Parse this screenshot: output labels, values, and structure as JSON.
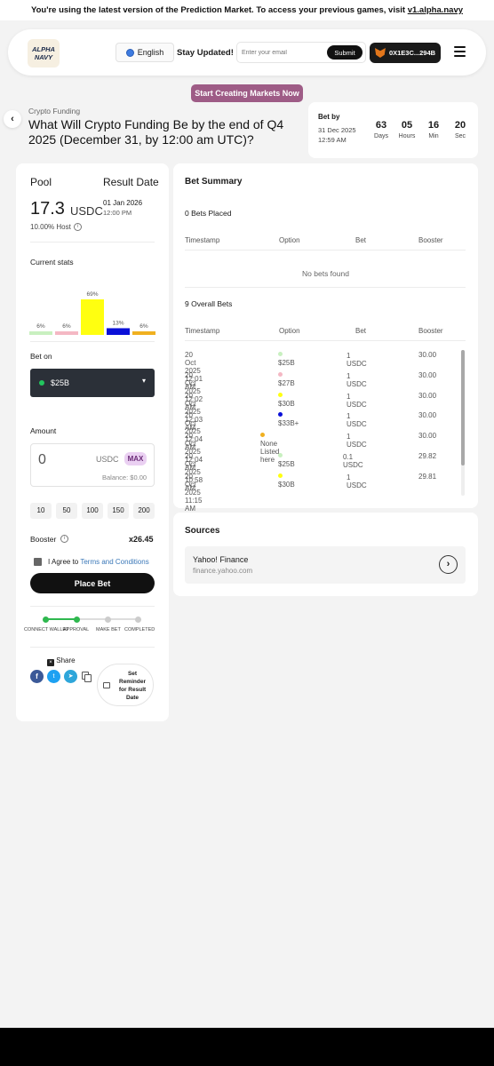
{
  "banner": {
    "text": "You're using the latest version of the Prediction Market. To access your previous games, visit ",
    "link": "v1.alpha.navy"
  },
  "navbar": {
    "logo": "ALPHA NAVY",
    "language": "English",
    "stay_updated": "Stay Updated!",
    "email_placeholder": "Enter your email",
    "submit": "Submit",
    "wallet": "0X1E3C...294B"
  },
  "cta": "Start Creating Markets Now",
  "market": {
    "category": "Crypto Funding",
    "question": "What Will Crypto Funding Be by the end of Q4 2025 (December 31, by 12:00 am UTC)?"
  },
  "bet_by": {
    "label": "Bet by",
    "date": "31 Dec 2025",
    "time": "12:59 AM",
    "countdown": [
      {
        "value": "63",
        "unit": "Days"
      },
      {
        "value": "05",
        "unit": "Hours"
      },
      {
        "value": "16",
        "unit": "Min"
      },
      {
        "value": "20",
        "unit": "Sec"
      }
    ]
  },
  "pool": {
    "label": "Pool",
    "result_label": "Result Date",
    "amount": "17.3",
    "currency": "USDC",
    "result_date": "01 Jan 2026",
    "result_time": "12:00 PM",
    "host": "10.00% Host"
  },
  "current_stats": {
    "title": "Current stats",
    "bars": [
      {
        "label": "6%",
        "value": 6,
        "color": "#c8f0c0"
      },
      {
        "label": "6%",
        "value": 6,
        "color": "#f4b8c4"
      },
      {
        "label": "69%",
        "value": 69,
        "color": "#ffff10"
      },
      {
        "label": "13%",
        "value": 13,
        "color": "#0a10d8"
      },
      {
        "label": "6%",
        "value": 6,
        "color": "#f0b020"
      }
    ]
  },
  "bet_on": {
    "label": "Bet on",
    "selected": "$25B",
    "dot_color": "#22c55e"
  },
  "amount": {
    "label": "Amount",
    "value": "0",
    "currency": "USDC",
    "max": "MAX",
    "balance": "Balance: $0.00",
    "presets": [
      "10",
      "50",
      "100",
      "150",
      "200"
    ]
  },
  "booster": {
    "label": "Booster",
    "value": "x26.45"
  },
  "terms": {
    "prefix": "I Agree to ",
    "link": "Terms and Conditions"
  },
  "place_bet": "Place Bet",
  "steps": [
    "CONNECT WALLET",
    "APPROVAL",
    "MAKE BET",
    "COMPLETED"
  ],
  "share": {
    "label": "Share",
    "reminder": "Set Reminder for Result Date"
  },
  "bet_summary": {
    "title": "Bet Summary",
    "placed_label": "0 Bets Placed",
    "columns": [
      "Timestamp",
      "Option",
      "Bet",
      "Booster"
    ],
    "empty": "No bets found",
    "overall_label": "9 Overall Bets",
    "rows": [
      {
        "timestamp": "20 Oct 2025 12:01 AM",
        "option": "$25B",
        "color": "#c8f0c0",
        "bet": "1 USDC",
        "booster": "30.00"
      },
      {
        "timestamp": "20 Oct 2025 12:02 AM",
        "option": "$27B",
        "color": "#f4b8c4",
        "bet": "1 USDC",
        "booster": "30.00"
      },
      {
        "timestamp": "20 Oct 2025 12:03 AM",
        "option": "$30B",
        "color": "#ffff10",
        "bet": "1 USDC",
        "booster": "30.00"
      },
      {
        "timestamp": "20 Oct 2025 12:04 AM",
        "option": "$33B+",
        "color": "#0a10d8",
        "bet": "1 USDC",
        "booster": "30.00"
      },
      {
        "timestamp": "20 Oct 2025 12:04 AM",
        "option": "None Listed here",
        "color": "#f0b020",
        "bet": "1 USDC",
        "booster": "30.00"
      },
      {
        "timestamp": "20 Oct 2025 10:58 AM",
        "option": "$25B",
        "color": "#c8f0c0",
        "bet": "0.1 USDC",
        "booster": "29.82"
      },
      {
        "timestamp": "20 Oct 2025 11:15 AM",
        "option": "$30B",
        "color": "#ffff10",
        "bet": "1 USDC",
        "booster": "29.81"
      }
    ]
  },
  "sources": {
    "title": "Sources",
    "items": [
      {
        "name": "Yahoo! Finance",
        "url": "finance.yahoo.com"
      }
    ]
  }
}
